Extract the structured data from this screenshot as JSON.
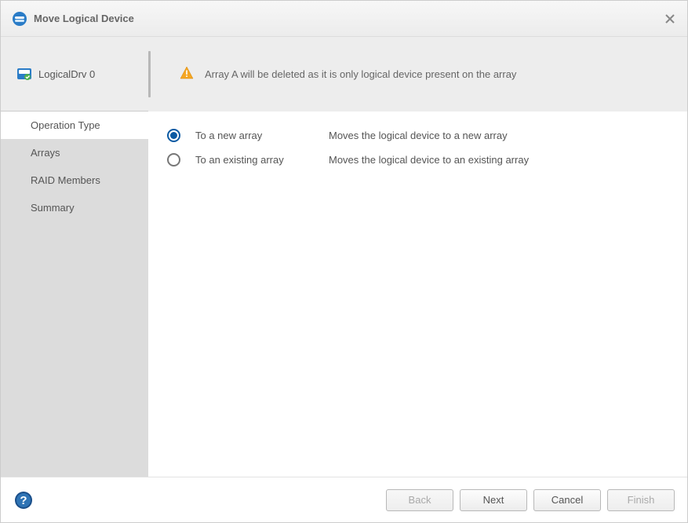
{
  "title": "Move Logical Device",
  "sidebar": {
    "device_name": "LogicalDrv 0",
    "steps": [
      {
        "label": "Operation Type",
        "active": true
      },
      {
        "label": "Arrays",
        "active": false
      },
      {
        "label": "RAID Members",
        "active": false
      },
      {
        "label": "Summary",
        "active": false
      }
    ]
  },
  "alert": {
    "text": "Array A will be deleted as it is only logical device present on the array"
  },
  "options": [
    {
      "label": "To a new array",
      "desc": "Moves the logical device to a new array",
      "selected": true
    },
    {
      "label": "To an existing array",
      "desc": "Moves the logical device to an existing array",
      "selected": false
    }
  ],
  "footer": {
    "back": "Back",
    "next": "Next",
    "cancel": "Cancel",
    "finish": "Finish"
  }
}
